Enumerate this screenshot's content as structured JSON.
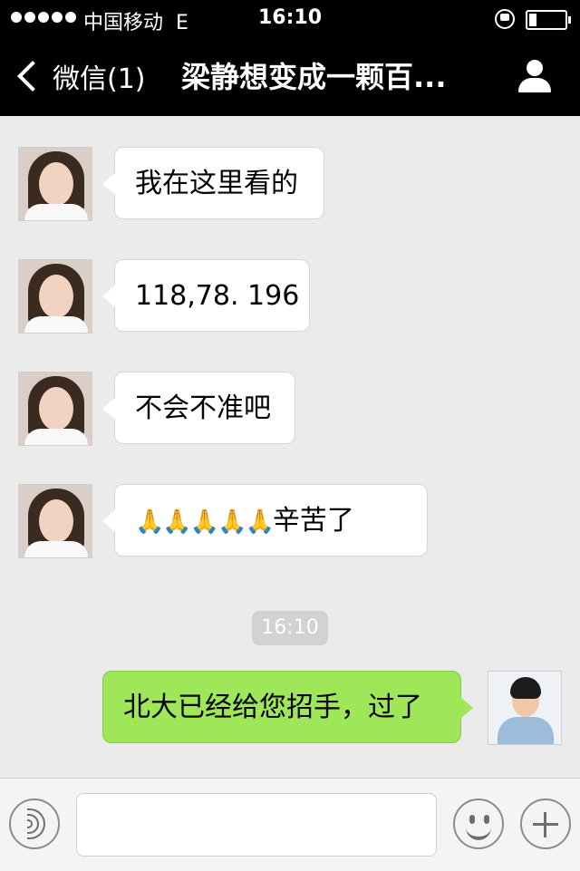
{
  "status_bar": {
    "carrier": "中国移动",
    "network": "E",
    "time": "16:10",
    "icons": [
      "signal-dots-icon",
      "rotation-lock-icon",
      "battery-icon"
    ]
  },
  "nav": {
    "back_label": "微信(1)",
    "title": "梁静想变成一颗百...",
    "profile_icon": "person-icon"
  },
  "messages": [
    {
      "from": "contact",
      "text": "我在这里看的"
    },
    {
      "from": "contact",
      "text": "118,78. 196"
    },
    {
      "from": "contact",
      "text": "不会不准吧"
    },
    {
      "from": "contact",
      "emoji": "🙏🙏🙏🙏🙏",
      "text": "辛苦了"
    },
    {
      "from": "me",
      "text": "北大已经给您招手，过了"
    }
  ],
  "timestamp": "16:10",
  "colors": {
    "background": "#ebebeb",
    "topbar": "#000000",
    "incoming_bubble": "#ffffff",
    "outgoing_bubble": "#9fe658"
  },
  "input_bar": {
    "voice_icon": "voice-icon",
    "emoji_icon": "smiley-icon",
    "more_icon": "plus-icon"
  }
}
